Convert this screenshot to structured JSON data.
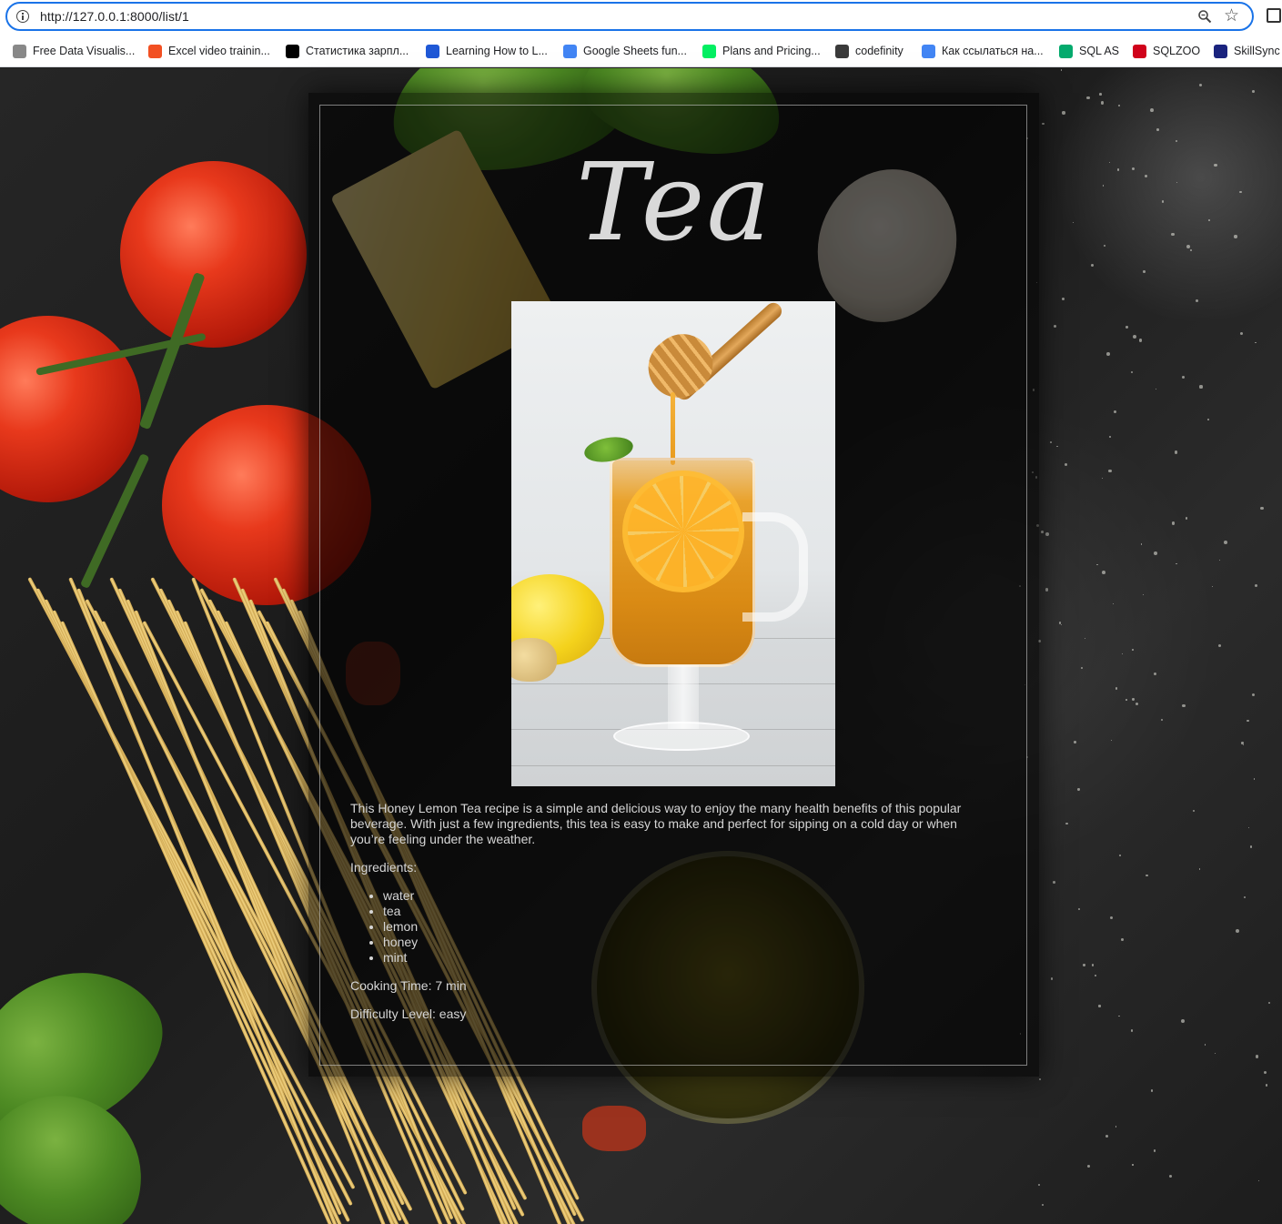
{
  "browser": {
    "url": "http://127.0.0.1:8000/list/1",
    "bookmarks": [
      {
        "label": "Free Data Visualis...",
        "icon": "sparkle-icon",
        "color": "#888888"
      },
      {
        "label": "Excel video trainin...",
        "icon": "microsoft-icon",
        "color": "#f25022"
      },
      {
        "label": "Статистика зарпл...",
        "icon": "dou-icon",
        "color": "#000000"
      },
      {
        "label": "Learning How to L...",
        "icon": "coursera-icon",
        "color": "#1f58d6"
      },
      {
        "label": "Google Sheets fun...",
        "icon": "google-icon",
        "color": "#4285f4"
      },
      {
        "label": "Plans and Pricing...",
        "icon": "datacamp-icon",
        "color": "#03ef62"
      },
      {
        "label": "codefinity",
        "icon": "codefinity-icon",
        "color": "#3a3a3a"
      },
      {
        "label": "Как ссылаться на...",
        "icon": "google-icon",
        "color": "#4285f4"
      },
      {
        "label": "SQL AS",
        "icon": "w3schools-icon",
        "color": "#04aa6d"
      },
      {
        "label": "SQLZOO",
        "icon": "sqlzoo-icon",
        "color": "#d0021b"
      },
      {
        "label": "SkillSync",
        "icon": "skillsync-icon",
        "color": "#1a237e"
      }
    ]
  },
  "recipe": {
    "title": "Tea",
    "image_alt": "honey-lemon-tea-photo",
    "description": "This Honey Lemon Tea recipe is a simple and delicious way to enjoy the many health benefits of this popular beverage. With just a few ingredients, this tea is easy to make and perfect for sipping on a cold day or when you’re feeling under the weather.",
    "ingredients_label": "Ingredients:",
    "ingredients": [
      "water",
      "tea",
      "lemon",
      "honey",
      "mint"
    ],
    "cooking_time": "Cooking Time: 7 min",
    "difficulty": "Difficulty Level: easy"
  },
  "colors": {
    "accent": "#1a73e8",
    "card_border": "#dcdcdc",
    "text": "#d6d6d6"
  }
}
